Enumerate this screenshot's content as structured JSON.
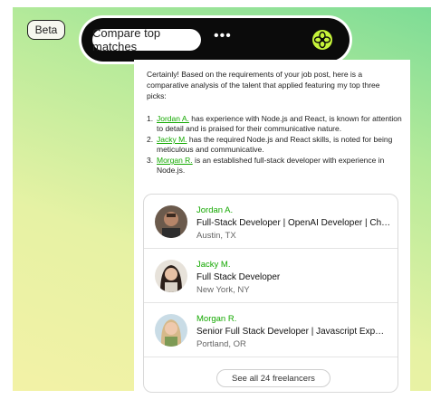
{
  "colors": {
    "accent_green": "#14a800",
    "pill_bg": "#0b0b0b",
    "logo_green": "#c6f43a"
  },
  "beta_label": "Beta",
  "header": {
    "compare_label": "Compare top matches",
    "more_label": "•••",
    "logo_icon": "ai-flower-icon"
  },
  "message": {
    "intro": "Certainly! Based on the requirements of your job post, here is a comparative analysis of the talent that applied featuring my top three picks:",
    "picks": [
      {
        "num": "1.",
        "name": "Jordan A.",
        "text": " has experience with Node.js and React, is known for attention to detail and is praised for their communicative nature."
      },
      {
        "num": "2.",
        "name": "Jacky M.",
        "text": " has the required Node.js and React skills, is noted for being meticulous and communicative."
      },
      {
        "num": "3.",
        "name": "Morgan R.",
        "text": " is an established full-stack developer with experience in Node.js."
      }
    ]
  },
  "freelancers": [
    {
      "name": "Jordan A.",
      "title": "Full-Stack Developer | OpenAI Developer | Ch…",
      "location": "Austin, TX"
    },
    {
      "name": "Jacky M.",
      "title": "Full Stack Developer",
      "location": "New York, NY"
    },
    {
      "name": "Morgan R.",
      "title": "Senior Full Stack Developer | Javascript Exp…",
      "location": "Portland, OR"
    }
  ],
  "see_all_label": "See all 24 freelancers"
}
